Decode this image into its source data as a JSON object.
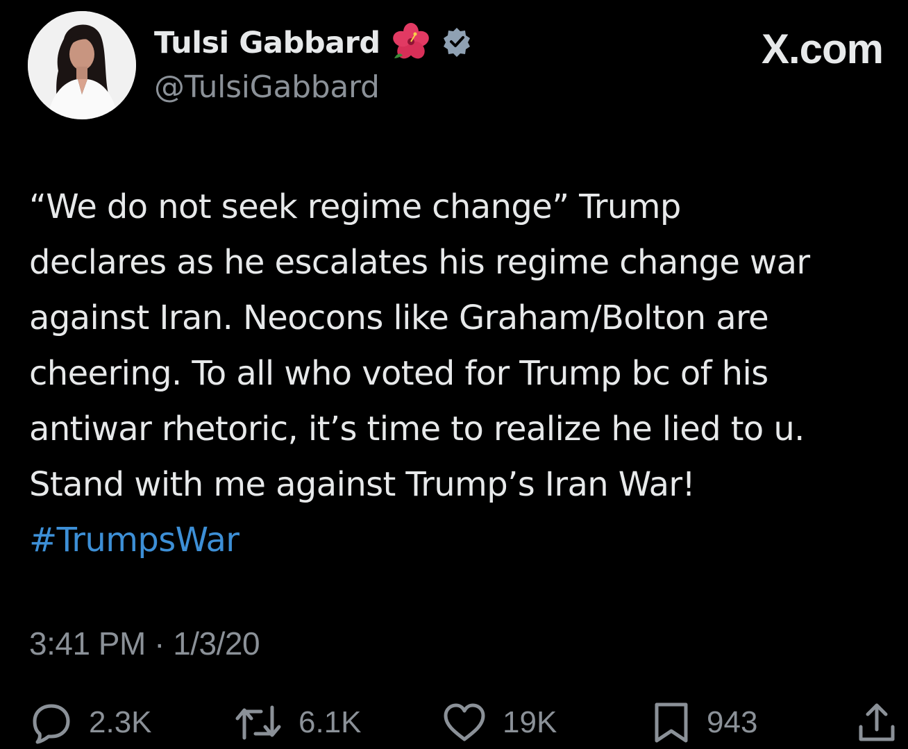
{
  "brand": "X.com",
  "author": {
    "display_name": "Tulsi Gabbard",
    "handle": "@TulsiGabbard",
    "emoji": "hibiscus-icon",
    "verified_icon": "verified-badge-icon",
    "avatar": "profile-photo"
  },
  "tweet": {
    "lines": [
      "“We do not seek regime change” Trump",
      "declares as he escalates his regime change war",
      "against Iran. Neocons like Graham/Bolton are",
      "cheering. To all who voted for Trump bc of his",
      "antiwar rhetoric, it’s time to realize he lied to u.",
      "Stand with me against Trump’s Iran War!"
    ],
    "hashtag": "#TrumpsWar",
    "timestamp": "3:41 PM · 1/3/20"
  },
  "actions": {
    "replies": "2.3K",
    "reposts": "6.1K",
    "likes": "19K",
    "bookmarks": "943",
    "share_icon": "share-icon"
  },
  "colors": {
    "background": "#000000",
    "text": "#e7e9ea",
    "muted": "#8b9198",
    "link": "#3d8fd6",
    "verified": "#8fa1b3"
  }
}
